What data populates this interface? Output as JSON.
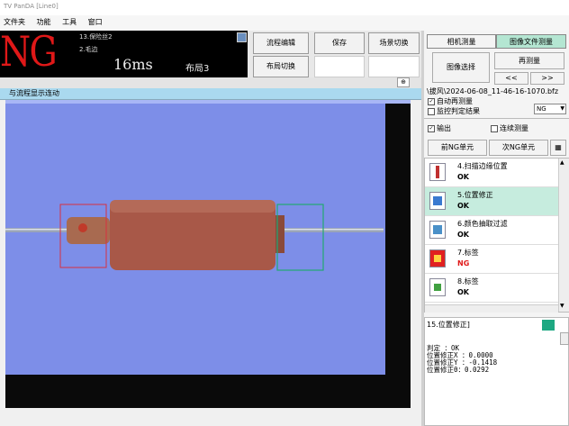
{
  "window": {
    "title": "TV PanDA [Line0]"
  },
  "menu": [
    {
      "label": "文件夹"
    },
    {
      "label": "功能"
    },
    {
      "label": "工具"
    },
    {
      "label": "窗口"
    }
  ],
  "header": {
    "result": "NG",
    "line1": "13.保险丝2",
    "line2": "2.毛边",
    "time": "16ms",
    "layout": "布局3"
  },
  "toolbar": {
    "flow_edit": "流程编辑",
    "save": "保存",
    "scene_switch": "场景切换",
    "layout_switch": "布局切换"
  },
  "strip": {
    "label": "与流程显示连动"
  },
  "right": {
    "tab_camera": "相机测量",
    "tab_image_file": "图像文件测量",
    "image_select": "图像选择",
    "remeasure": "再测量",
    "prev": "<<",
    "next": ">>",
    "path": "\\拔风\\2024-06-08_11-46-16-1070.bfz",
    "auto_remeasure": "自动再测量",
    "monitor_label": "监控判定结果",
    "monitor_value": "NG",
    "output": "输出",
    "continuous": "连续测量",
    "prev_ng": "前NG单元",
    "next_ng": "次NG单元"
  },
  "units": [
    {
      "name": "4.扫描边缘位置",
      "status": "OK",
      "icon": "edge-scan-icon",
      "selected": false,
      "ng": false
    },
    {
      "name": "5.位置修正",
      "status": "OK",
      "icon": "position-correct-icon",
      "selected": true,
      "ng": false
    },
    {
      "name": "6.颜色抽取过滤",
      "status": "OK",
      "icon": "color-extract-icon",
      "selected": false,
      "ng": false
    },
    {
      "name": "7.标签",
      "status": "NG",
      "icon": "label-icon",
      "selected": false,
      "ng": true
    },
    {
      "name": "8.标签",
      "status": "OK",
      "icon": "label-icon",
      "selected": false,
      "ng": false
    }
  ],
  "detail": {
    "title": "15.位置修正]",
    "lines": [
      "判定 ：OK",
      "位置修正X ：0.0000",
      "位置修正Y ：-0.1418",
      "位置修正θ：0.0292"
    ]
  },
  "colors": {
    "ng": "#e01818",
    "view_bg": "#8091e9",
    "selected_unit": "#c6ecde",
    "ng_box": "#d83040",
    "ok_box": "#22a872"
  }
}
